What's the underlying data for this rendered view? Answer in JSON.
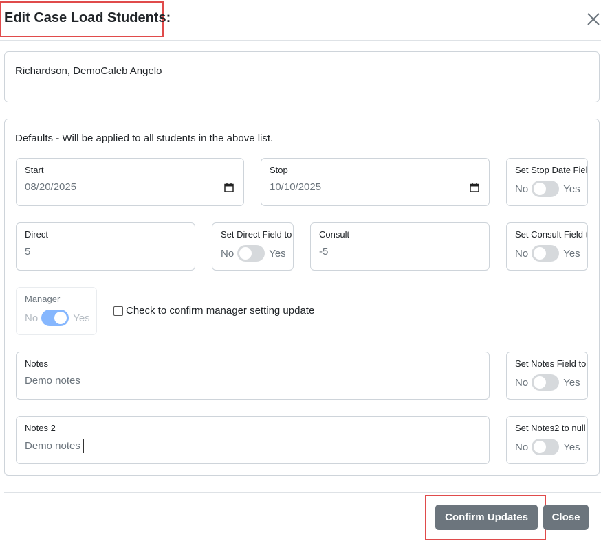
{
  "modal": {
    "title": "Edit Case Load Students:",
    "students_list": "Richardson, DemoCaleb Angelo",
    "defaults_caption": "Defaults - Will be applied to all students in the above list."
  },
  "fields": {
    "start": {
      "label": "Start",
      "value": "08/20/2025"
    },
    "stop": {
      "label": "Stop",
      "value": "10/10/2025"
    },
    "direct": {
      "label": "Direct",
      "value": "5"
    },
    "consult": {
      "label": "Consult",
      "value": "-5"
    },
    "notes": {
      "label": "Notes",
      "value": "Demo notes"
    },
    "notes2": {
      "label": "Notes 2",
      "value": "Demo notes"
    }
  },
  "switches": {
    "no_label": "No",
    "yes_label": "Yes",
    "stop_null": {
      "label": "Set Stop Date Field to null",
      "on": false
    },
    "direct_null": {
      "label": "Set Direct Field to null",
      "on": false
    },
    "consult_null": {
      "label": "Set Consult Field to null",
      "on": false
    },
    "manager": {
      "label": "Manager",
      "on": true,
      "disabled": true
    },
    "notes_null": {
      "label": "Set Notes Field to null",
      "on": false
    },
    "notes2_null": {
      "label": "Set Notes2 to null",
      "on": false
    }
  },
  "manager_confirm_label": "Check to confirm manager setting update",
  "footer": {
    "confirm_label": "Confirm Updates",
    "close_label": "Close"
  },
  "colors": {
    "highlight": "#e04b4b",
    "button": "#6c757d",
    "toggle_on": "#86b7fe",
    "toggle_off": "#d6d9dc"
  }
}
